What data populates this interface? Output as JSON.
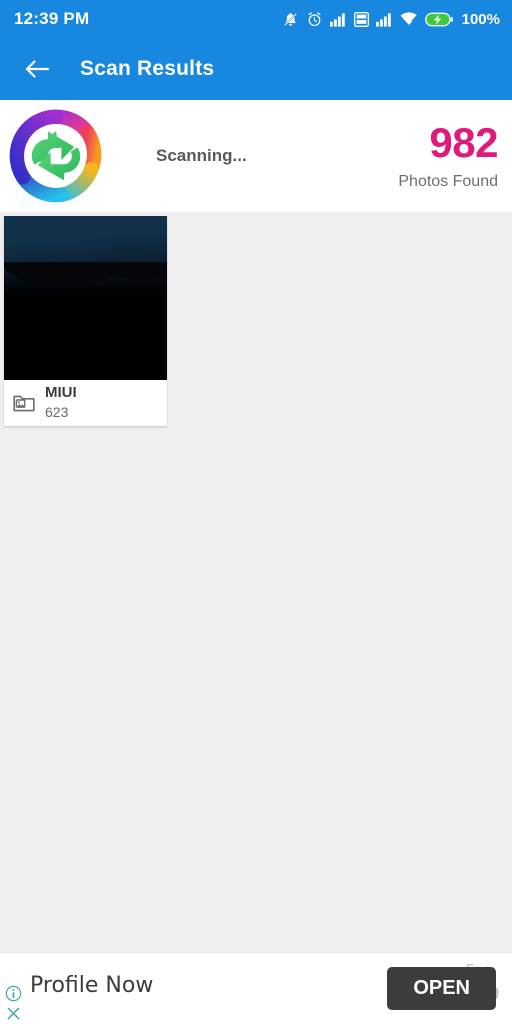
{
  "statusbar": {
    "time": "12:39 PM",
    "battery_percent": "100%",
    "icons": [
      "bell-muted-icon",
      "alarm-clock-icon",
      "signal-bars-icon",
      "volte-icon",
      "signal-bars-2-icon",
      "wifi-icon",
      "battery-charging-icon"
    ]
  },
  "appbar": {
    "title": "Scan Results",
    "back_icon": "back-arrow-icon"
  },
  "scan": {
    "logo_icon": "photo-recovery-logo-icon",
    "status_text": "Scanning...",
    "count": "982",
    "count_label": "Photos Found"
  },
  "results": {
    "albums": [
      {
        "name": "MIUI",
        "count": "623",
        "folder_icon": "photo-folder-icon"
      }
    ]
  },
  "ad": {
    "title": "Profile Now",
    "sub_line1": "Fac",
    "sub_line2": "Co",
    "open_label": "OPEN",
    "info_icon": "info-icon",
    "close_icon": "close-icon",
    "accent": "#3c3c3c",
    "badge_color": "#3aa8a8"
  },
  "colors": {
    "brand_blue": "#1787e0",
    "count_magenta": "#e0197a",
    "page_bg": "#efefef"
  }
}
